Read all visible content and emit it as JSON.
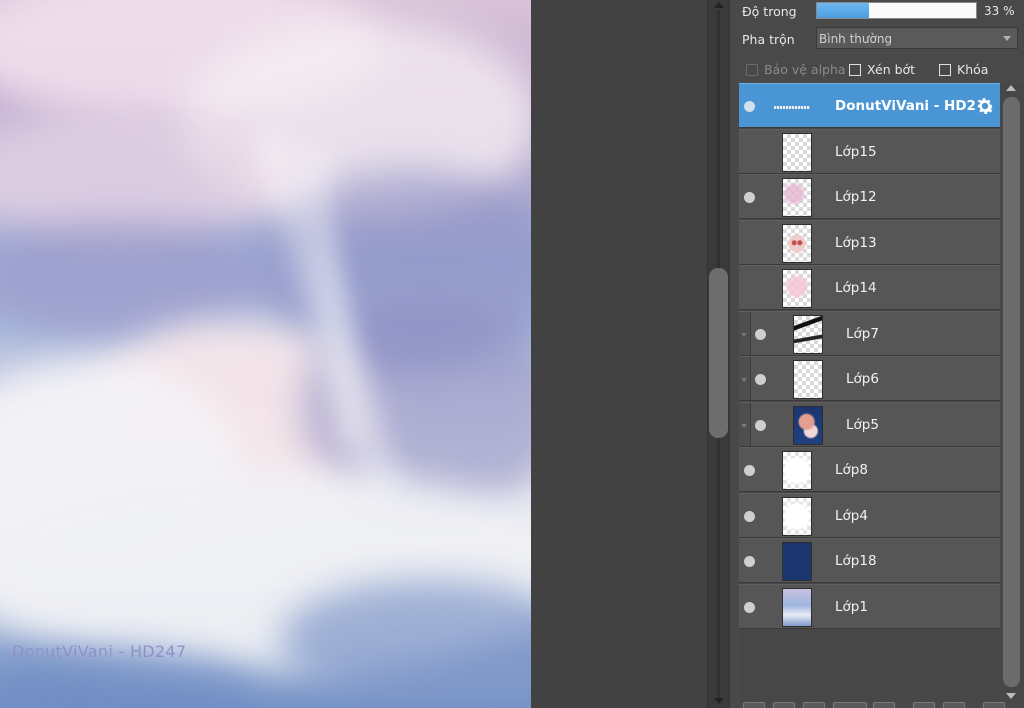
{
  "canvas": {
    "watermark": "DonutViVani - HD247"
  },
  "panel": {
    "opacity": {
      "label": "Độ trong",
      "value_text": "33 %",
      "fraction": 0.33
    },
    "blend": {
      "label": "Pha trộn",
      "value": "Bình thường"
    },
    "checkboxes": [
      {
        "label": "Bảo vệ alpha",
        "checked": false,
        "enabled": false
      },
      {
        "label": "Xén bớt",
        "checked": false,
        "enabled": true
      },
      {
        "label": "Khóa",
        "checked": false,
        "enabled": true
      }
    ],
    "layers": [
      {
        "name": "DonutViVani - HD2",
        "visible": true,
        "selected": true,
        "in_group": false,
        "thumb": "text-strip"
      },
      {
        "name": "Lớp15",
        "visible": false,
        "selected": false,
        "in_group": false,
        "thumb": "transparent"
      },
      {
        "name": "Lớp12",
        "visible": true,
        "selected": false,
        "in_group": false,
        "thumb": "pink"
      },
      {
        "name": "Lớp13",
        "visible": false,
        "selected": false,
        "in_group": false,
        "thumb": "red-dots"
      },
      {
        "name": "Lớp14",
        "visible": false,
        "selected": false,
        "in_group": false,
        "thumb": "pink-soft"
      },
      {
        "name": "Lớp7",
        "visible": true,
        "selected": false,
        "in_group": true,
        "thumb": "black-strokes"
      },
      {
        "name": "Lớp6",
        "visible": true,
        "selected": false,
        "in_group": true,
        "thumb": "transparent"
      },
      {
        "name": "Lớp5",
        "visible": true,
        "selected": false,
        "in_group": true,
        "thumb": "navy-figure"
      },
      {
        "name": "Lớp8",
        "visible": true,
        "selected": false,
        "in_group": false,
        "thumb": "white-clouds"
      },
      {
        "name": "Lớp4",
        "visible": true,
        "selected": false,
        "in_group": false,
        "thumb": "white-clouds"
      },
      {
        "name": "Lớp18",
        "visible": true,
        "selected": false,
        "in_group": false,
        "thumb": "navy-solid"
      },
      {
        "name": "Lớp1",
        "visible": true,
        "selected": false,
        "in_group": false,
        "thumb": "sky"
      }
    ]
  },
  "colors": {
    "selection": "#4a96d4",
    "opacity_fill": "#5aa8e6",
    "navy": "#1c3670"
  },
  "icons": {
    "layer_settings": "gear-icon",
    "visibility": "eye-dot-icon"
  }
}
